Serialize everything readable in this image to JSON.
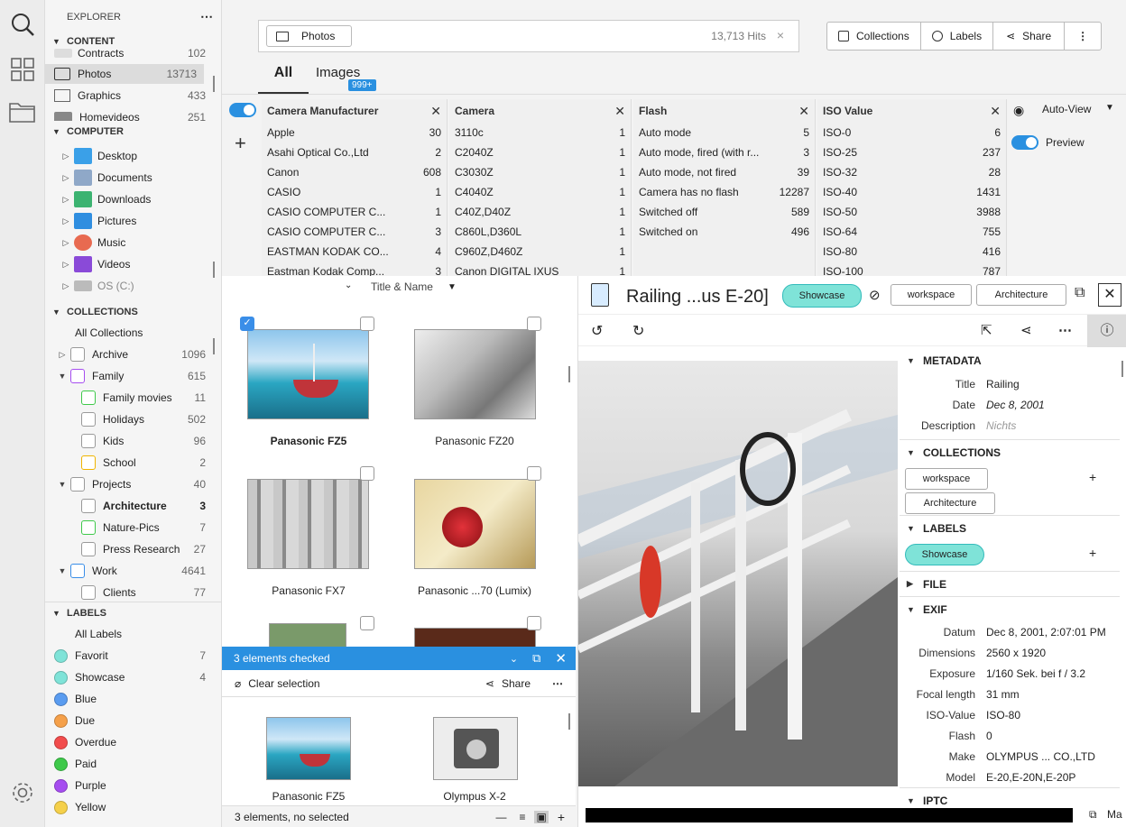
{
  "sidebar": {
    "explorer": "EXPLORER",
    "content": {
      "title": "CONTENT",
      "items": [
        {
          "label": "Contracts",
          "count": "102"
        },
        {
          "label": "Photos",
          "count": "13713"
        },
        {
          "label": "Graphics",
          "count": "433"
        },
        {
          "label": "Homevideos",
          "count": "251"
        }
      ]
    },
    "computer": {
      "title": "COMPUTER",
      "items": [
        {
          "label": "Desktop"
        },
        {
          "label": "Documents"
        },
        {
          "label": "Downloads"
        },
        {
          "label": "Pictures"
        },
        {
          "label": "Music"
        },
        {
          "label": "Videos"
        },
        {
          "label": "OS (C:)"
        }
      ]
    },
    "collections": {
      "title": "COLLECTIONS",
      "all": "All Collections",
      "items": [
        {
          "label": "Archive",
          "count": "1096"
        },
        {
          "label": "Family",
          "count": "615"
        },
        {
          "label": "Family movies",
          "count": "11"
        },
        {
          "label": "Holidays",
          "count": "502"
        },
        {
          "label": "Kids",
          "count": "96"
        },
        {
          "label": "School",
          "count": "2"
        },
        {
          "label": "Projects",
          "count": "40"
        },
        {
          "label": "Architecture",
          "count": "3"
        },
        {
          "label": "Nature-Pics",
          "count": "7"
        },
        {
          "label": "Press Research",
          "count": "27"
        },
        {
          "label": "Work",
          "count": "4641"
        },
        {
          "label": "Clients",
          "count": "77"
        }
      ]
    },
    "labels": {
      "title": "LABELS",
      "all": "All Labels",
      "items": [
        {
          "label": "Favorit",
          "count": "7",
          "color": "#7fe3d8"
        },
        {
          "label": "Showcase",
          "count": "4",
          "color": "#7fe3d8"
        },
        {
          "label": "Blue",
          "count": "",
          "color": "#5a9cf0"
        },
        {
          "label": "Due",
          "count": "",
          "color": "#f5a04a"
        },
        {
          "label": "Overdue",
          "count": "",
          "color": "#f24c4c"
        },
        {
          "label": "Paid",
          "count": "",
          "color": "#3ec94a"
        },
        {
          "label": "Purple",
          "count": "",
          "color": "#a64df0"
        },
        {
          "label": "Yellow",
          "count": "",
          "color": "#f5d04a"
        }
      ]
    }
  },
  "search": {
    "chip": "Photos",
    "hits": "13,713 Hits"
  },
  "toolbar": {
    "collections": "Collections",
    "labels": "Labels",
    "share": "Share"
  },
  "tabs": {
    "all": "All",
    "images": "Images",
    "images_badge": "999+"
  },
  "facets": [
    {
      "title": "Camera Manufacturer",
      "rows": [
        [
          "Apple",
          "30"
        ],
        [
          "Asahi Optical Co.,Ltd",
          "2"
        ],
        [
          "Canon",
          "608"
        ],
        [
          "CASIO",
          "1"
        ],
        [
          "CASIO COMPUTER C...",
          "1"
        ],
        [
          "CASIO COMPUTER C...",
          "3"
        ],
        [
          "EASTMAN KODAK CO...",
          "4"
        ],
        [
          "Eastman Kodak Comp...",
          "3"
        ]
      ]
    },
    {
      "title": "Camera",
      "rows": [
        [
          "3110c",
          "1"
        ],
        [
          "C2040Z",
          "1"
        ],
        [
          "C3030Z",
          "1"
        ],
        [
          "C4040Z",
          "1"
        ],
        [
          "C40Z,D40Z",
          "1"
        ],
        [
          "C860L,D360L",
          "1"
        ],
        [
          "C960Z,D460Z",
          "1"
        ],
        [
          "Canon DIGITAL IXUS",
          "1"
        ]
      ]
    },
    {
      "title": "Flash",
      "rows": [
        [
          "Auto mode",
          "5"
        ],
        [
          "Auto mode, fired (with r...",
          "3"
        ],
        [
          "Auto mode, not fired",
          "39"
        ],
        [
          "Camera has no flash",
          "12287"
        ],
        [
          "Switched off",
          "589"
        ],
        [
          "Switched on",
          "496"
        ]
      ]
    },
    {
      "title": "ISO Value",
      "rows": [
        [
          "ISO-0",
          "6"
        ],
        [
          "ISO-25",
          "237"
        ],
        [
          "ISO-32",
          "28"
        ],
        [
          "ISO-40",
          "1431"
        ],
        [
          "ISO-50",
          "3988"
        ],
        [
          "ISO-64",
          "755"
        ],
        [
          "ISO-80",
          "416"
        ],
        [
          "ISO-100",
          "787"
        ]
      ]
    }
  ],
  "autoview": "Auto-View",
  "preview_label": "Preview",
  "sort": "Title & Name",
  "grid": [
    {
      "caption": "Panasonic FZ5"
    },
    {
      "caption": "Panasonic FZ20"
    },
    {
      "caption": "Panasonic FX7"
    },
    {
      "caption": "Panasonic ...70 (Lumix)"
    }
  ],
  "checked": {
    "title": "3 elements checked",
    "clear": "Clear selection",
    "share": "Share",
    "items": [
      {
        "caption": "Panasonic FZ5"
      },
      {
        "caption": "Olympus X-2"
      }
    ]
  },
  "status": "3 elements, no selected",
  "detail": {
    "title": "Railing ...us E-20]",
    "label_chip": "Showcase",
    "collection_chips": [
      "workspace",
      "Architecture"
    ],
    "metadata": {
      "title": "METADATA",
      "rows": [
        {
          "k": "Title",
          "v": "Railing"
        },
        {
          "k": "Date",
          "v": "Dec 8, 2001"
        },
        {
          "k": "Description",
          "v": "Nichts"
        }
      ]
    },
    "collections": {
      "title": "COLLECTIONS",
      "items": [
        "workspace",
        "Architecture"
      ]
    },
    "labels": {
      "title": "LABELS",
      "items": [
        "Showcase"
      ]
    },
    "file": "FILE",
    "exif": {
      "title": "EXIF",
      "rows": [
        {
          "k": "Datum",
          "v": "Dec 8, 2001, 2:07:01 PM"
        },
        {
          "k": "Dimensions",
          "v": "2560 x 1920"
        },
        {
          "k": "Exposure",
          "v": "1/160 Sek. bei f / 3.2"
        },
        {
          "k": "Focal length",
          "v": "31 mm"
        },
        {
          "k": "ISO-Value",
          "v": "ISO-80"
        },
        {
          "k": "Flash",
          "v": "0"
        },
        {
          "k": "Make",
          "v": "OLYMPUS ... CO.,LTD"
        },
        {
          "k": "Model",
          "v": "E-20,E-20N,E-20P"
        }
      ]
    },
    "iptc": "IPTC",
    "footer": "Ma"
  }
}
